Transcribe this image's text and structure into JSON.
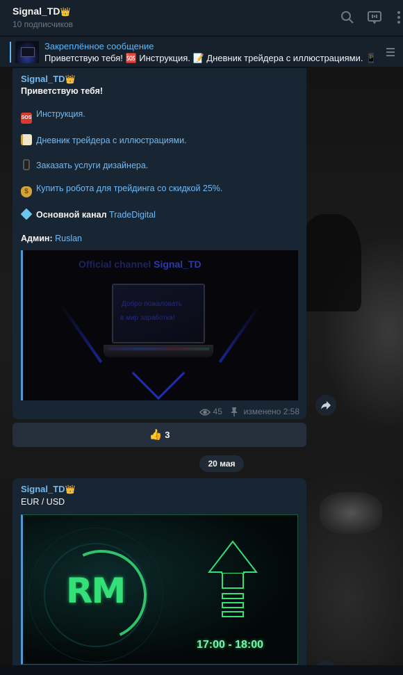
{
  "header": {
    "channel_name": "Signal_TD",
    "channel_crown": "👑",
    "subscribers": "10 подписчиков",
    "icons": [
      "search-icon",
      "livestream-icon",
      "more-icon"
    ]
  },
  "pinned": {
    "title": "Закреплённое сообщение",
    "text": "Приветствую тебя! 🆘 Инструкция. 📝 Дневник трейдера с иллюстрациями. 📱"
  },
  "message1": {
    "sender": "Signal_TD",
    "greeting": "Приветствую тебя!",
    "lines": [
      {
        "emoji": "SOS",
        "text": "Инструкция."
      },
      {
        "emoji": "memo",
        "text": "Дневник трейдера с иллюстрациями."
      },
      {
        "emoji": "phone",
        "text": "Заказать услуги дизайнера."
      },
      {
        "emoji": "$",
        "text": "Купить робота для трейдинга со скидкой 25%."
      }
    ],
    "main_channel_label": "Основной канал",
    "main_channel_link": "TradeDigital",
    "admin_label": "Админ:",
    "admin_link": "Ruslan",
    "image": {
      "title_part1": "Official channel",
      "title_part2": "Signal_TD",
      "screen_line1": "Добро пожаловать",
      "screen_line2": "в мир заработка!"
    },
    "views": "45",
    "edited": "изменено 2:58"
  },
  "reaction": {
    "emoji": "👍",
    "count": "3"
  },
  "date_separator": "20 мая",
  "message2": {
    "sender": "Signal_TD",
    "text": "EUR / USD",
    "image": {
      "logo_text": "RM",
      "time_range": "17:00 - 18:00"
    }
  },
  "colors": {
    "accent": "#71baf3",
    "bubble": "#182533",
    "header": "#17212b",
    "neon_green": "#35e07a"
  }
}
